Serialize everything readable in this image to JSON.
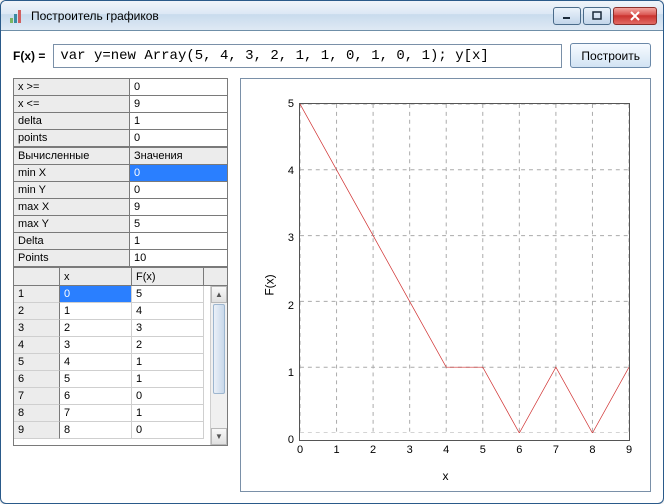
{
  "window": {
    "title": "Построитель графиков"
  },
  "formula": {
    "label": "F(x) =",
    "value": "var y=new Array(5, 4, 3, 2, 1, 1, 0, 1, 0, 1); y[x]",
    "build_btn": "Построить"
  },
  "params": {
    "rows": [
      {
        "label": "x >=",
        "value": "0"
      },
      {
        "label": "x <=",
        "value": "9"
      },
      {
        "label": "delta",
        "value": "1"
      },
      {
        "label": "points",
        "value": "0"
      }
    ]
  },
  "computed": {
    "header": {
      "label": "Вычисленные",
      "value": "Значения"
    },
    "rows": [
      {
        "label": "min X",
        "value": "0",
        "selected": true
      },
      {
        "label": "min Y",
        "value": "0"
      },
      {
        "label": "max X",
        "value": "9"
      },
      {
        "label": "max Y",
        "value": "5"
      },
      {
        "label": "Delta",
        "value": "1"
      },
      {
        "label": "Points",
        "value": "10"
      }
    ]
  },
  "dataset": {
    "headers": {
      "idx": "",
      "x": "x",
      "f": "F(x)"
    },
    "rows": [
      {
        "idx": "1",
        "x": "0",
        "f": "5",
        "selected": true
      },
      {
        "idx": "2",
        "x": "1",
        "f": "4"
      },
      {
        "idx": "3",
        "x": "2",
        "f": "3"
      },
      {
        "idx": "4",
        "x": "3",
        "f": "2"
      },
      {
        "idx": "5",
        "x": "4",
        "f": "1"
      },
      {
        "idx": "6",
        "x": "5",
        "f": "1"
      },
      {
        "idx": "7",
        "x": "6",
        "f": "0"
      },
      {
        "idx": "8",
        "x": "7",
        "f": "1"
      },
      {
        "idx": "9",
        "x": "8",
        "f": "0"
      }
    ]
  },
  "chart_data": {
    "type": "line",
    "x": [
      0,
      1,
      2,
      3,
      4,
      5,
      6,
      7,
      8,
      9
    ],
    "values": [
      5,
      4,
      3,
      2,
      1,
      1,
      0,
      1,
      0,
      1
    ],
    "xlabel": "x",
    "ylabel": "F(x)",
    "xlim": [
      0,
      9
    ],
    "ylim": [
      0,
      5
    ],
    "xticks": [
      0,
      1,
      2,
      3,
      4,
      5,
      6,
      7,
      8,
      9
    ],
    "yticks": [
      0,
      1,
      2,
      3,
      4,
      5
    ],
    "color": "#d03030"
  }
}
